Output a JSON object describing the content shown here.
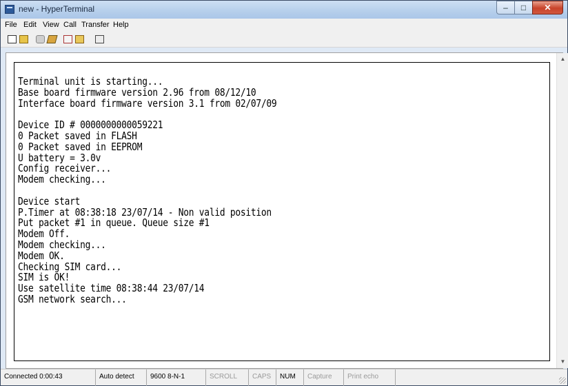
{
  "window": {
    "title": "new - HyperTerminal",
    "controls": {
      "minimize": "–",
      "maximize": "□",
      "close": "✕"
    }
  },
  "menu": [
    "File",
    "Edit",
    "View",
    "Call",
    "Transfer",
    "Help"
  ],
  "toolbar": {
    "icons": [
      "new-icon",
      "open-icon",
      "phone-icon",
      "disconnect-icon",
      "send-icon",
      "receive-icon",
      "properties-icon"
    ]
  },
  "terminal": {
    "lines": [
      "Terminal unit is starting...",
      "Base board firmware version 2.96 from 08/12/10",
      "Interface board firmware version 3.1 from 02/07/09",
      "",
      "Device ID # 0000000000059221",
      "0 Packet saved in FLASH",
      "0 Packet saved in EEPROM",
      "U battery = 3.0v",
      "Config receiver...",
      "Modem checking...",
      "",
      "Device start",
      "P.Timer at 08:38:18 23/07/14 - Non valid position",
      "Put packet #1 in queue. Queue size #1",
      "Modem Off.",
      "Modem checking...",
      "Modem OK.",
      "Checking SIM card...",
      "SIM is OK!",
      "Use satellite time 08:38:44 23/07/14",
      "GSM network search..."
    ]
  },
  "scrollbar": {
    "up": "▲",
    "down": "▼"
  },
  "status": {
    "connected": "Connected 0:00:43",
    "detect": "Auto detect",
    "settings": "9600 8-N-1",
    "scroll": "SCROLL",
    "caps": "CAPS",
    "num": "NUM",
    "capture": "Capture",
    "print_echo": "Print echo"
  }
}
